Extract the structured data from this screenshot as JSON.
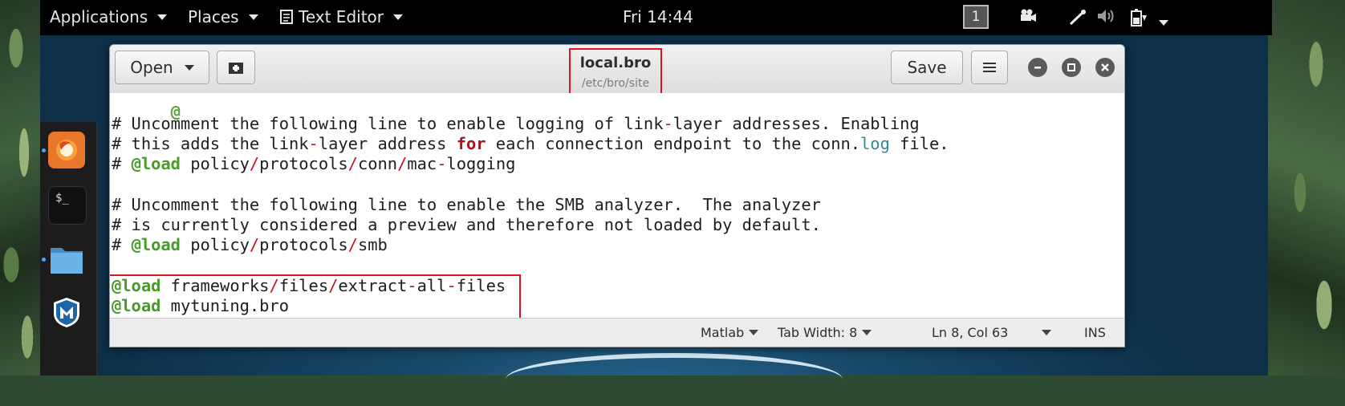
{
  "panel": {
    "applications": "Applications",
    "places": "Places",
    "text_editor": "Text Editor",
    "clock": "Fri 14:44",
    "workspace": "1"
  },
  "window": {
    "open_label": "Open",
    "title": "local.bro",
    "subtitle": "/etc/bro/site",
    "save_label": "Save"
  },
  "editor": {
    "lines": [
      [
        [
          "c",
          "# Uncomment the following line to enable logging of link"
        ],
        [
          "o",
          "-"
        ],
        [
          "c",
          "layer addresses. Enabling"
        ]
      ],
      [
        [
          "c",
          "# this adds the link"
        ],
        [
          "o",
          "-"
        ],
        [
          "c",
          "layer address "
        ],
        [
          "f",
          "for"
        ],
        [
          "c",
          " each connection endpoint to the conn."
        ],
        [
          "l",
          "log"
        ],
        [
          "c",
          " file."
        ]
      ],
      [
        [
          "c",
          "# "
        ],
        [
          "k",
          "@load"
        ],
        [
          "c",
          " policy"
        ],
        [
          "o",
          "/"
        ],
        [
          "c",
          "protocols"
        ],
        [
          "o",
          "/"
        ],
        [
          "c",
          "conn"
        ],
        [
          "o",
          "/"
        ],
        [
          "c",
          "mac"
        ],
        [
          "o",
          "-"
        ],
        [
          "c",
          "logging"
        ]
      ],
      [
        [
          "c",
          ""
        ]
      ],
      [
        [
          "c",
          "# Uncomment the following line to enable the SMB analyzer.  The analyzer"
        ]
      ],
      [
        [
          "c",
          "# is currently considered a preview and therefore not loaded by default."
        ]
      ],
      [
        [
          "c",
          "# "
        ],
        [
          "k",
          "@load"
        ],
        [
          "c",
          " policy"
        ],
        [
          "o",
          "/"
        ],
        [
          "c",
          "protocols"
        ],
        [
          "o",
          "/"
        ],
        [
          "c",
          "smb"
        ]
      ],
      [
        [
          "c",
          ""
        ]
      ],
      [
        [
          "k",
          "@load"
        ],
        [
          "c",
          " frameworks"
        ],
        [
          "o",
          "/"
        ],
        [
          "c",
          "files"
        ],
        [
          "o",
          "/"
        ],
        [
          "c",
          "extract"
        ],
        [
          "o",
          "-"
        ],
        [
          "c",
          "all"
        ],
        [
          "o",
          "-"
        ],
        [
          "c",
          "files"
        ]
      ],
      [
        [
          "k",
          "@load"
        ],
        [
          "c",
          " mytuning.bro"
        ]
      ]
    ]
  },
  "status": {
    "language": "Matlab",
    "tab_width": "Tab Width: 8",
    "position": "Ln 8, Col 63",
    "mode": "INS"
  },
  "colors": {
    "keyword": "#4a9a2b",
    "operator": "#c4141e",
    "highlight_box": "#e0141e",
    "log_word": "#2c8c9a"
  }
}
